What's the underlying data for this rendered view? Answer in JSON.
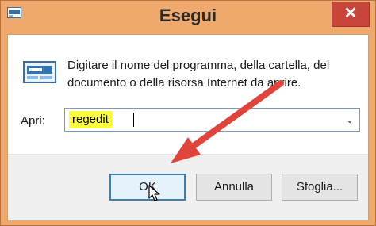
{
  "window": {
    "title": "Esegui",
    "close_glyph": "✕",
    "icon": "run-dialog-icon"
  },
  "dialog": {
    "description": "Digitare il nome del programma, della cartella, del documento o della risorsa Internet da aprire.",
    "open_label": "Apri:",
    "input_value": "regedit",
    "dropdown_glyph": "⌄"
  },
  "buttons": {
    "ok": "OK",
    "cancel": "Annulla",
    "browse": "Sfoglia..."
  },
  "colors": {
    "title_bar": "#f0a96c",
    "close_button": "#c7453a",
    "highlight": "#fbff3b",
    "annotation_arrow": "#e0443a"
  }
}
